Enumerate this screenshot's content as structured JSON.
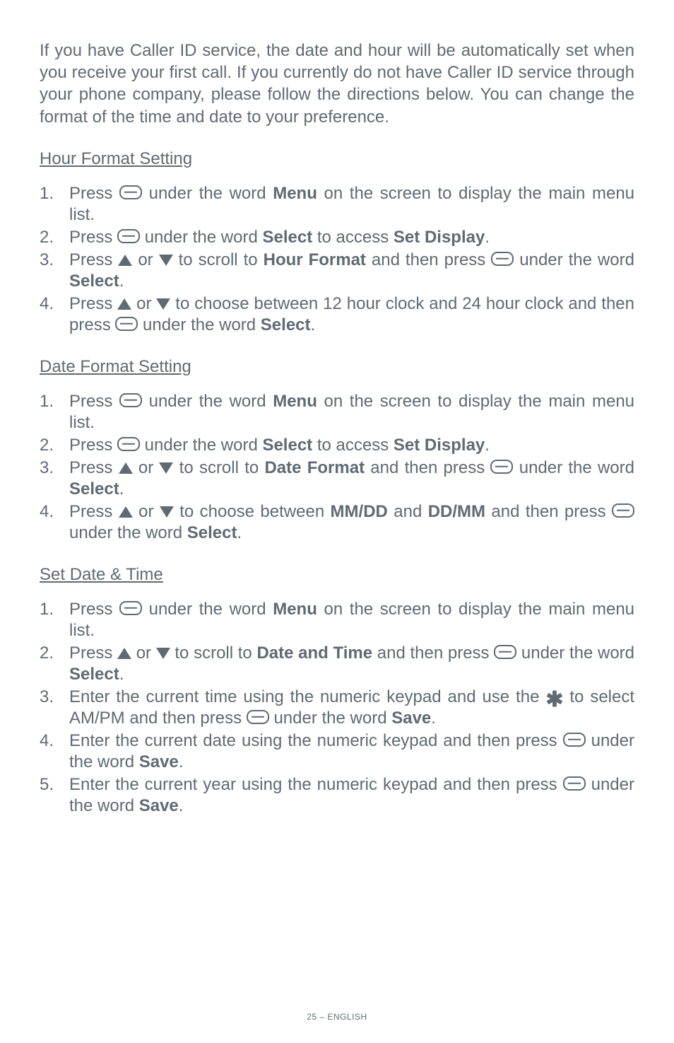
{
  "intro": "If you have Caller ID service, the date and hour will be automatically set when you receive your first call. If you currently do not have Caller ID service through your phone company, please follow the directions below.  You can change the format of the time and date to your preference.",
  "sections": {
    "hour": {
      "heading": "Hour Format Setting",
      "s1_a": "Press",
      "s1_b": "under the word ",
      "s1_menu": "Menu",
      "s1_c": " on the screen to display the main menu list.",
      "s2_a": "Press",
      "s2_b": "under the word ",
      "s2_select": "Select",
      "s2_c": " to access ",
      "s2_setdisplay": "Set Display",
      "s2_d": ".",
      "s3_a": "Press ",
      "s3_or": "or ",
      "s3_b": "to scroll to ",
      "s3_hf": "Hour Format",
      "s3_c": " and then press ",
      "s3_d": " under the word ",
      "s3_select": "Select",
      "s3_e": ".",
      "s4_a": "Press ",
      "s4_or": " or ",
      "s4_b": " to choose between 12 hour clock and 24 hour clock and then press ",
      "s4_c": " under the word ",
      "s4_select": "Select",
      "s4_d": "."
    },
    "date": {
      "heading": "Date Format Setting",
      "s1_a": "Press ",
      "s1_b": "under the word ",
      "s1_menu": "Menu",
      "s1_c": " on the screen to display the main menu list.",
      "s2_a": "Press ",
      "s2_b": " under the word ",
      "s2_select": "Select",
      "s2_c": " to access ",
      "s2_setdisplay": "Set Display",
      "s2_d": ".",
      "s3_a": "Press ",
      "s3_or": "or ",
      "s3_b": " to scroll to ",
      "s3_df": "Date Format",
      "s3_c": " and then press ",
      "s3_d": " under the word ",
      "s3_select": "Select",
      "s3_e": ".",
      "s4_a": "Press ",
      "s4_or": "or ",
      "s4_b": "to choose between ",
      "s4_mmdd": "MM/DD",
      "s4_and": " and ",
      "s4_ddmm": "DD/MM",
      "s4_c": " and then press ",
      "s4_d": " under the word ",
      "s4_select": "Select",
      "s4_e": "."
    },
    "setdt": {
      "heading": "Set Date & Time",
      "s1_a": "Press ",
      "s1_b": "under the word ",
      "s1_menu": "Menu",
      "s1_c": " on the screen to display the main menu list.",
      "s2_a": "Press ",
      "s2_or": "or ",
      "s2_b": "to scroll to ",
      "s2_dt": "Date and Time",
      "s2_c": " and then press ",
      "s2_d": " under the word ",
      "s2_select": "Select",
      "s2_e": ".",
      "s3_a": "Enter the current time using the numeric keypad and use the ",
      "s3_b": " to select AM/PM and then press ",
      "s3_c": " under the word ",
      "s3_save": "Save",
      "s3_d": ".",
      "s4_a": "Enter the current date using the numeric keypad and then press ",
      "s4_b": " under the word ",
      "s4_save": "Save",
      "s4_c": ".",
      "s5_a": "Enter the current year using the numeric keypad and then press ",
      "s5_b": " under the word ",
      "s5_save": "Save",
      "s5_c": "."
    }
  },
  "nums": {
    "n1": "1.",
    "n2": "2.",
    "n3": "3.",
    "n4": "4.",
    "n5": "5."
  },
  "icons": {
    "star": "✱"
  },
  "footer": "25 – ENGLISH"
}
